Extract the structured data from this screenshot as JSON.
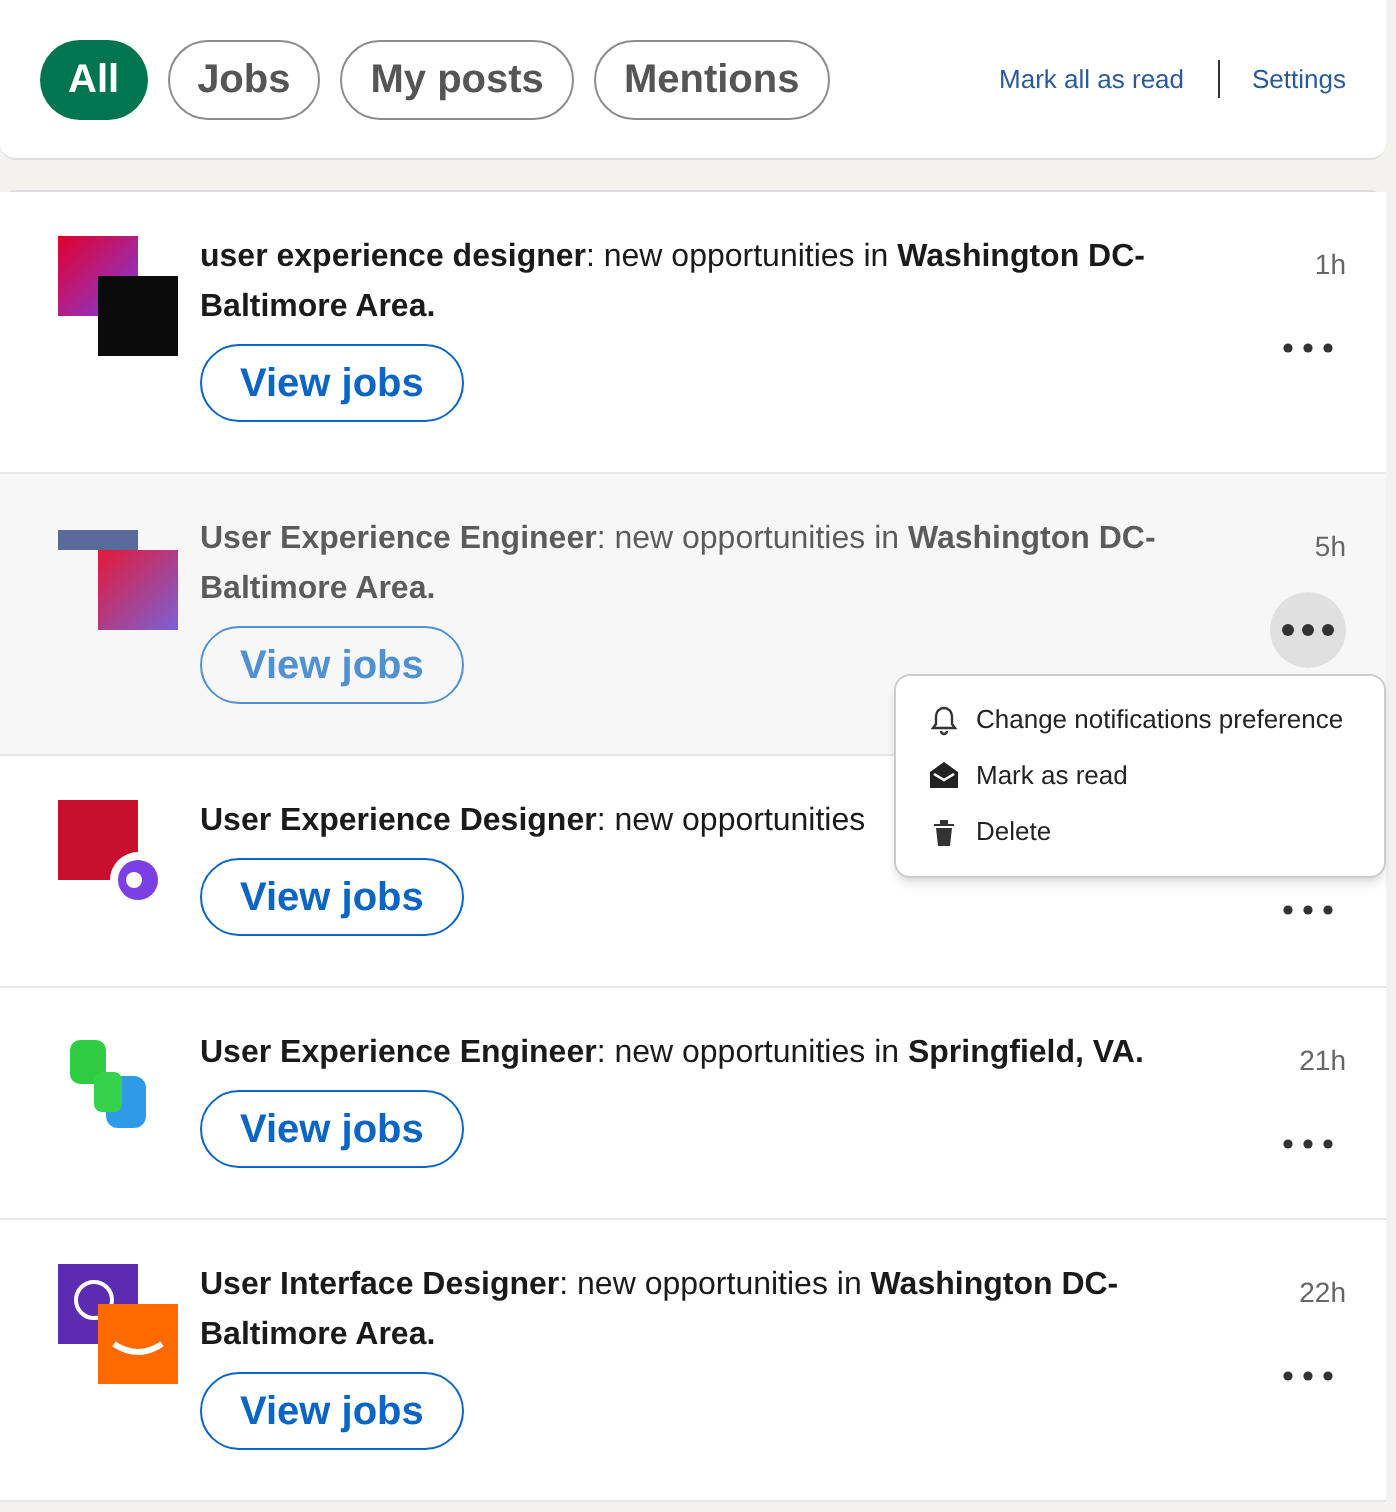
{
  "filters": [
    {
      "label": "All",
      "selected": true
    },
    {
      "label": "Jobs",
      "selected": false
    },
    {
      "label": "My posts",
      "selected": false
    },
    {
      "label": "Mentions",
      "selected": false
    }
  ],
  "header_links": [
    "Mark all as read",
    "Settings"
  ],
  "notifications": [
    {
      "message": "**user experience designer**: new opportunities in **Washington DC-Baltimore Area.**",
      "time": "1h",
      "button": "View jobs",
      "hovered": false
    },
    {
      "message": "**User Experience Engineer**: new opportunities in **Washington DC-Baltimore Area.**",
      "time": "5h",
      "button": "View jobs",
      "hovered": true,
      "menu": [
        "Change notifications preference",
        "Mark as read",
        "Delete"
      ]
    },
    {
      "message": "**User Experience Designer**: new opportunities",
      "button": "View jobs",
      "hovered": false
    },
    {
      "message": "**User Experience Engineer**: new opportunities in **Springfield, VA.**",
      "time": "21h",
      "button": "View jobs",
      "hovered": false
    },
    {
      "message": "**User Interface Designer**: new opportunities in **Washington DC-Baltimore Area.**",
      "time": "22h",
      "button": "View jobs",
      "hovered": false
    }
  ]
}
